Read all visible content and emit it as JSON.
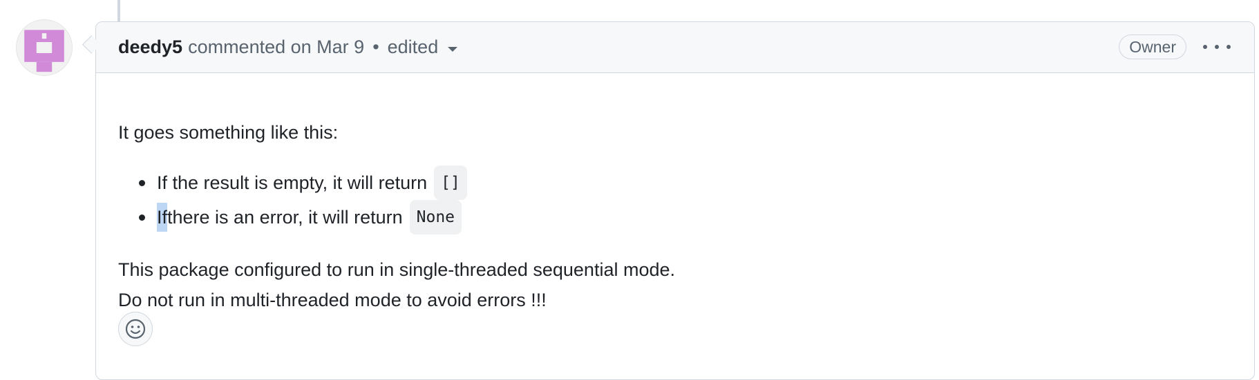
{
  "comment": {
    "author": "deedy5",
    "meta_text": "commented on Mar 9",
    "separator": "•",
    "edited_label": "edited",
    "role_badge": "Owner",
    "body": {
      "intro": "It goes something like this:",
      "list_items": [
        {
          "text": "If the result is empty, it will return",
          "code": "[]"
        },
        {
          "highlight": "If",
          "text": " there is an error, it will return",
          "code": "None"
        }
      ],
      "paragraph_line1": "This package configured to run in single-threaded sequential mode.",
      "paragraph_line2": "Do not run in multi-threaded mode to avoid errors !!!"
    }
  },
  "icons": {
    "avatar": "identicon-avatar",
    "menu": "kebab-horizontal-icon",
    "reaction": "smiley-icon",
    "dropdown": "triangle-down-icon"
  },
  "colors": {
    "avatar_accent": "#d08ad7",
    "border": "#d0d7de",
    "header_bg": "#f6f8fa",
    "selection": "#bcd6f4"
  }
}
